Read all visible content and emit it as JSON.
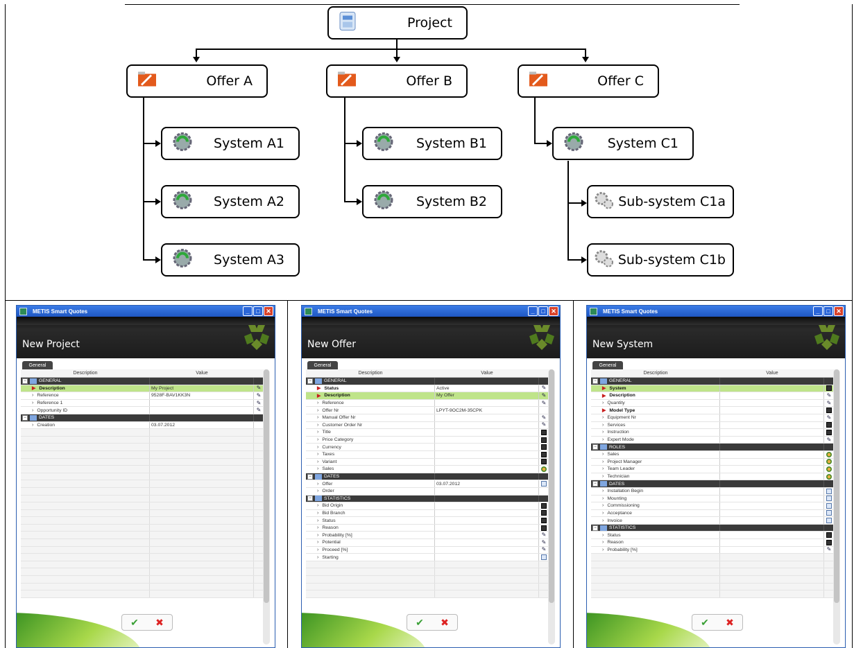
{
  "tree": {
    "root": "Project",
    "offers": [
      "Offer A",
      "Offer B",
      "Offer C"
    ],
    "systems_a": [
      "System A1",
      "System A2",
      "System A3"
    ],
    "systems_b": [
      "System B1",
      "System B2"
    ],
    "systems_c": [
      "System C1"
    ],
    "subsystems_c": [
      "Sub-system C1a",
      "Sub-system C1b"
    ]
  },
  "windows": [
    {
      "app_title": "METIS Smart Quotes",
      "heading": "New Project",
      "tab": "General",
      "col_desc": "Description",
      "col_value": "Value",
      "rows": [
        {
          "type": "section",
          "label": "GENERAL"
        },
        {
          "label": "Description",
          "value": "My Project",
          "req": true,
          "bold": true,
          "sel": true,
          "icon": "edit"
        },
        {
          "label": "Reference",
          "value": "9528F-BAV1KK3N",
          "icon": "edit"
        },
        {
          "label": "Reference 1",
          "value": "",
          "icon": "edit"
        },
        {
          "label": "Opportunity ID",
          "value": "",
          "icon": "edit"
        },
        {
          "type": "section",
          "label": "DATES"
        },
        {
          "label": "Creation",
          "value": "03.07.2012",
          "icon": ""
        }
      ]
    },
    {
      "app_title": "METIS Smart Quotes",
      "heading": "New Offer",
      "tab": "General",
      "col_desc": "Description",
      "col_value": "Value",
      "rows": [
        {
          "type": "section",
          "label": "GENERAL"
        },
        {
          "label": "Status",
          "value": "Active",
          "req": true,
          "bold": true,
          "icon": "edit"
        },
        {
          "label": "Description",
          "value": "My Offer",
          "req": true,
          "bold": true,
          "sel": true,
          "icon": "edit"
        },
        {
          "label": "Reference",
          "value": "",
          "icon": "edit"
        },
        {
          "label": "Offer Nr",
          "value": "LPYT-9OC2M-35CPK",
          "icon": ""
        },
        {
          "label": "Manual Offer Nr",
          "value": "",
          "icon": "edit"
        },
        {
          "label": "Customer Order Nr",
          "value": "",
          "icon": "edit"
        },
        {
          "label": "Title",
          "value": "",
          "icon": "dd"
        },
        {
          "label": "Price Category",
          "value": "",
          "icon": "dd"
        },
        {
          "label": "Currency",
          "value": "",
          "icon": "dd"
        },
        {
          "label": "Taxes",
          "value": "",
          "icon": "dd"
        },
        {
          "label": "Variant",
          "value": "",
          "icon": "dd"
        },
        {
          "label": "Sales",
          "value": "",
          "icon": "user"
        },
        {
          "type": "section",
          "label": "DATES"
        },
        {
          "label": "Offer",
          "value": "03.07.2012",
          "icon": "cal"
        },
        {
          "label": "Order",
          "value": "",
          "icon": ""
        },
        {
          "type": "section",
          "label": "STATISTICS"
        },
        {
          "label": "Bid Origin",
          "value": "",
          "icon": "dd"
        },
        {
          "label": "Bid Branch",
          "value": "",
          "icon": "dd"
        },
        {
          "label": "Status",
          "value": "",
          "icon": "dd"
        },
        {
          "label": "Reason",
          "value": "",
          "icon": "dd"
        },
        {
          "label": "Probability [%]",
          "value": "",
          "icon": "edit"
        },
        {
          "label": "Potential",
          "value": "",
          "icon": "edit"
        },
        {
          "label": "Proceed [%]",
          "value": "",
          "icon": "edit"
        },
        {
          "label": "Starting",
          "value": "",
          "icon": "cal"
        }
      ]
    },
    {
      "app_title": "METIS Smart Quotes",
      "heading": "New System",
      "tab": "General",
      "col_desc": "Description",
      "col_value": "Value",
      "rows": [
        {
          "type": "section",
          "label": "GENERAL"
        },
        {
          "label": "System",
          "value": "",
          "req": true,
          "bold": true,
          "sel": true,
          "icon": "dd"
        },
        {
          "label": "Description",
          "value": "",
          "req": true,
          "bold": true,
          "icon": "edit"
        },
        {
          "label": "Quantity",
          "value": "",
          "icon": "edit"
        },
        {
          "label": "Model Type",
          "value": "",
          "req": true,
          "bold": true,
          "icon": "dd"
        },
        {
          "label": "Equipment Nr",
          "value": "",
          "icon": "edit"
        },
        {
          "label": "Services",
          "value": "",
          "icon": "dd"
        },
        {
          "label": "Instruction",
          "value": "",
          "icon": "dd"
        },
        {
          "label": "Expert Mode",
          "value": "",
          "icon": "edit"
        },
        {
          "type": "section",
          "label": "ROLES"
        },
        {
          "label": "Sales",
          "value": "",
          "icon": "user"
        },
        {
          "label": "Project Manager",
          "value": "",
          "icon": "user"
        },
        {
          "label": "Team Leader",
          "value": "",
          "icon": "user"
        },
        {
          "label": "Technician",
          "value": "",
          "icon": "user"
        },
        {
          "type": "section",
          "label": "DATES"
        },
        {
          "label": "Installation Begin",
          "value": "",
          "icon": "cal"
        },
        {
          "label": "Mounting",
          "value": "",
          "icon": "cal"
        },
        {
          "label": "Commissioning",
          "value": "",
          "icon": "cal"
        },
        {
          "label": "Acceptance",
          "value": "",
          "icon": "cal"
        },
        {
          "label": "Invoice",
          "value": "",
          "icon": "cal"
        },
        {
          "type": "section",
          "label": "STATISTICS"
        },
        {
          "label": "Status",
          "value": "",
          "icon": "dd"
        },
        {
          "label": "Reason",
          "value": "",
          "icon": "dd"
        },
        {
          "label": "Probability [%]",
          "value": "",
          "icon": "edit"
        }
      ]
    }
  ],
  "buttons": {
    "ok": "✔",
    "cancel": "✖"
  },
  "icons": {
    "edit": "pencil-edit-icon",
    "dd": "dropdown-icon",
    "user": "user-icon",
    "cal": "calendar-icon"
  }
}
